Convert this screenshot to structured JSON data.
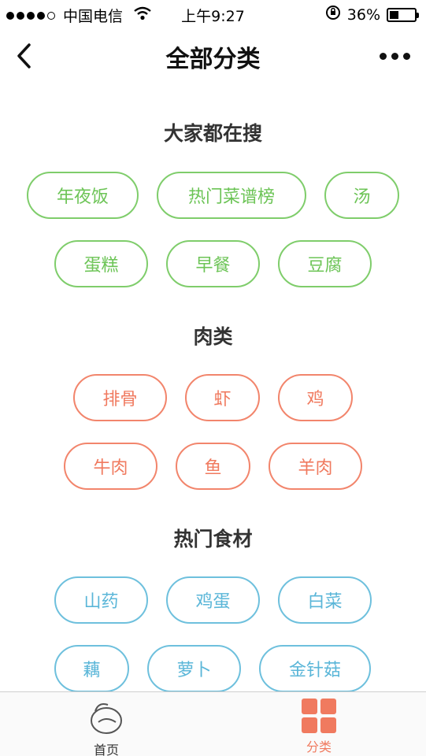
{
  "status": {
    "carrier": "中国电信",
    "time": "上午9:27",
    "battery": "36%",
    "battery_level": 0.36
  },
  "nav": {
    "title": "全部分类"
  },
  "sections": [
    {
      "title": "大家都在搜",
      "tags": [
        "年夜饭",
        "热门菜谱榜",
        "汤",
        "蛋糕",
        "早餐",
        "豆腐"
      ]
    },
    {
      "title": "肉类",
      "tags": [
        "排骨",
        "虾",
        "鸡",
        "牛肉",
        "鱼",
        "羊肉"
      ]
    },
    {
      "title": "热门食材",
      "tags": [
        "山药",
        "鸡蛋",
        "白菜",
        "藕",
        "萝卜",
        "金针菇"
      ]
    }
  ],
  "tabbar": {
    "home_label": "首页",
    "category_label": "分类"
  },
  "colors": {
    "green": "#7fcd6b",
    "orange": "#f07a5f",
    "blue": "#5ab6d8"
  }
}
